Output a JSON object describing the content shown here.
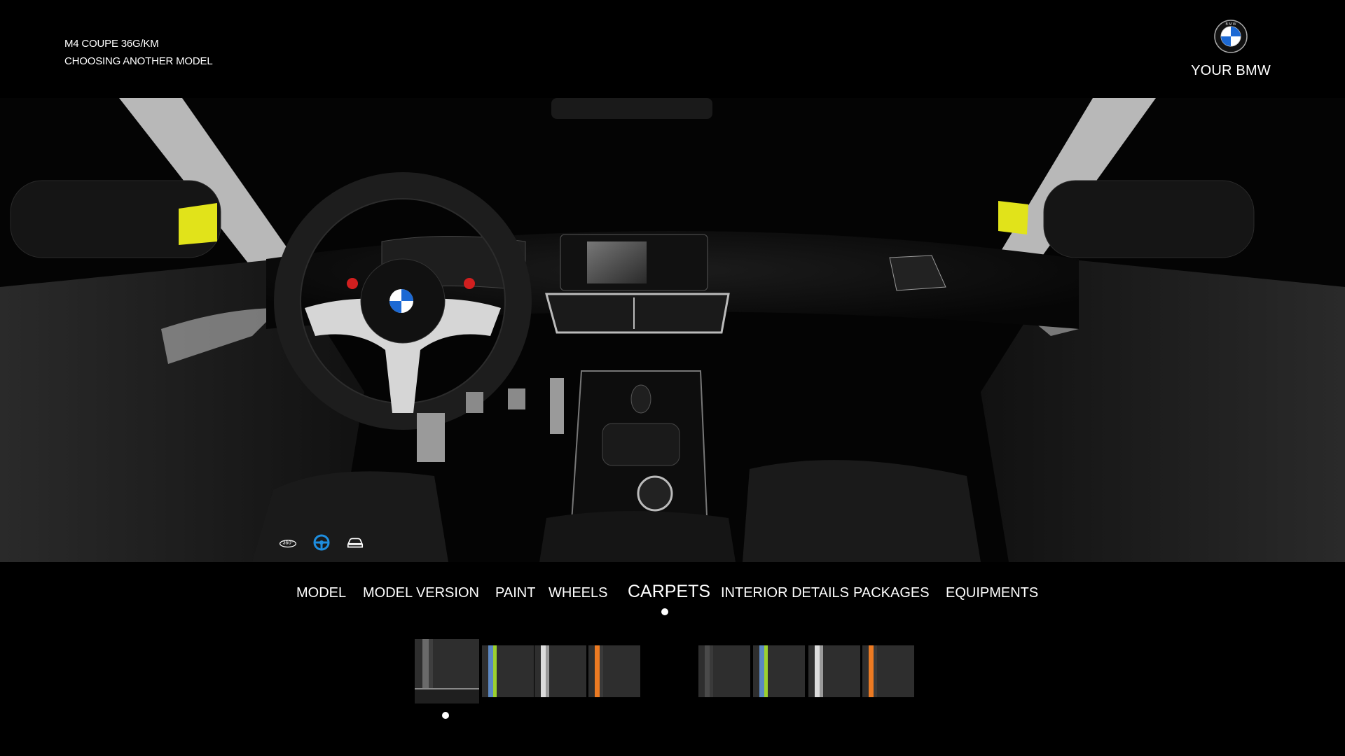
{
  "header": {
    "model_line": "M4 COUPE  36G/KM",
    "choose_link": "CHOOSING ANOTHER MODEL"
  },
  "brand": {
    "label": "YOUR BMW",
    "logo_icon": "bmw-roundel-icon"
  },
  "view_toggles": [
    {
      "icon": "360-view-icon",
      "label": "360°"
    },
    {
      "icon": "steering-wheel-icon",
      "active": true
    },
    {
      "icon": "car-exterior-icon"
    }
  ],
  "tabs": [
    {
      "label": "MODEL"
    },
    {
      "label": "MODEL VERSION"
    },
    {
      "label": "PAINT"
    },
    {
      "label": "WHEELS"
    },
    {
      "label": "CARPETS",
      "active": true
    },
    {
      "label": "INTERIOR DETAILS"
    },
    {
      "label": "PACKAGES"
    },
    {
      "label": "EQUIPMENTS"
    }
  ],
  "swatch_groups": [
    {
      "swatches": [
        {
          "stripe": "#6a6a6a",
          "accent": "#3f3f3f",
          "selected": true
        },
        {
          "stripe": "#5b87c2",
          "accent": "#9cd02e"
        },
        {
          "stripe": "#dcdcdc",
          "accent": "#9a9a9a"
        },
        {
          "stripe": "#ec7a22",
          "accent": "#3a3a3a"
        }
      ]
    },
    {
      "swatches": [
        {
          "stripe": "#4a4a4a",
          "accent": "#3a3a3a"
        },
        {
          "stripe": "#5b87c2",
          "accent": "#9cd02e"
        },
        {
          "stripe": "#dcdcdc",
          "accent": "#9a9a9a"
        },
        {
          "stripe": "#ec7a22",
          "accent": "#3a3a3a"
        }
      ]
    }
  ],
  "colors": {
    "background": "#000000",
    "text": "#ffffff",
    "accent_blue": "#1e8ee0",
    "seatbelt_yellow": "#e1e31a",
    "m_red": "#d11f1f"
  }
}
